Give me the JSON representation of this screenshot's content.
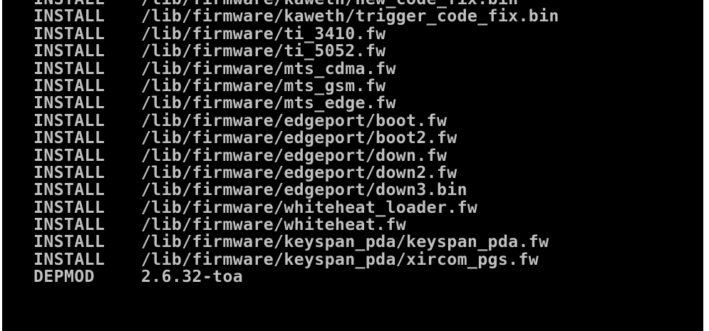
{
  "terminal": {
    "lines": [
      {
        "cmd": "INSTALL",
        "path": "/lib/firmware/kaweth/new_code_fix.bin"
      },
      {
        "cmd": "INSTALL",
        "path": "/lib/firmware/kaweth/trigger_code_fix.bin"
      },
      {
        "cmd": "INSTALL",
        "path": "/lib/firmware/ti_3410.fw"
      },
      {
        "cmd": "INSTALL",
        "path": "/lib/firmware/ti_5052.fw"
      },
      {
        "cmd": "INSTALL",
        "path": "/lib/firmware/mts_cdma.fw"
      },
      {
        "cmd": "INSTALL",
        "path": "/lib/firmware/mts_gsm.fw"
      },
      {
        "cmd": "INSTALL",
        "path": "/lib/firmware/mts_edge.fw"
      },
      {
        "cmd": "INSTALL",
        "path": "/lib/firmware/edgeport/boot.fw"
      },
      {
        "cmd": "INSTALL",
        "path": "/lib/firmware/edgeport/boot2.fw"
      },
      {
        "cmd": "INSTALL",
        "path": "/lib/firmware/edgeport/down.fw"
      },
      {
        "cmd": "INSTALL",
        "path": "/lib/firmware/edgeport/down2.fw"
      },
      {
        "cmd": "INSTALL",
        "path": "/lib/firmware/edgeport/down3.bin"
      },
      {
        "cmd": "INSTALL",
        "path": "/lib/firmware/whiteheat_loader.fw"
      },
      {
        "cmd": "INSTALL",
        "path": "/lib/firmware/whiteheat.fw"
      },
      {
        "cmd": "INSTALL",
        "path": "/lib/firmware/keyspan_pda/keyspan_pda.fw"
      },
      {
        "cmd": "INSTALL",
        "path": "/lib/firmware/keyspan_pda/xircom_pgs.fw"
      },
      {
        "cmd": "DEPMOD",
        "path": "2.6.32-toa"
      }
    ],
    "colors": {
      "background": "#000000",
      "text": "#c0c0c0"
    }
  }
}
